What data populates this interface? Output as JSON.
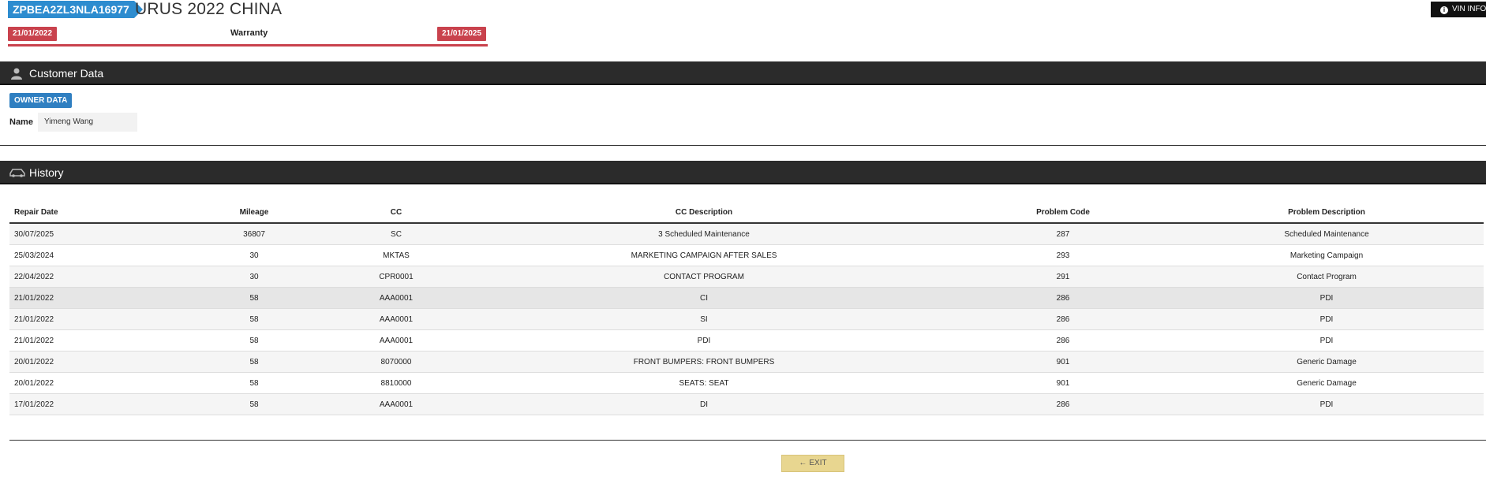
{
  "header": {
    "vin": "ZPBEA2ZL3NLA16977",
    "model": "URUS 2022 CHINA",
    "vin_info_label": "VIN INFO",
    "warranty_label": "Warranty",
    "warranty_start": "21/01/2022",
    "warranty_end": "21/01/2025"
  },
  "customer": {
    "section_title": "Customer Data",
    "owner_button": "OWNER DATA",
    "name_label": "Name",
    "name_value": "Yimeng Wang"
  },
  "history": {
    "section_title": "History",
    "columns": [
      "Repair Date",
      "Mileage",
      "CC",
      "CC Description",
      "Problem Code",
      "Problem Description"
    ],
    "rows": [
      [
        "30/07/2025",
        "36807",
        "SC",
        "3 Scheduled Maintenance",
        "287",
        "Scheduled Maintenance"
      ],
      [
        "25/03/2024",
        "30",
        "MKTAS",
        "MARKETING CAMPAIGN AFTER SALES",
        "293",
        "Marketing Campaign"
      ],
      [
        "22/04/2022",
        "30",
        "CPR0001",
        "CONTACT PROGRAM",
        "291",
        "Contact Program"
      ],
      [
        "21/01/2022",
        "58",
        "AAA0001",
        "CI",
        "286",
        "PDI"
      ],
      [
        "21/01/2022",
        "58",
        "AAA0001",
        "SI",
        "286",
        "PDI"
      ],
      [
        "21/01/2022",
        "58",
        "AAA0001",
        "PDI",
        "286",
        "PDI"
      ],
      [
        "20/01/2022",
        "58",
        "8070000",
        "FRONT BUMPERS: FRONT BUMPERS",
        "901",
        "Generic Damage"
      ],
      [
        "20/01/2022",
        "58",
        "8810000",
        "SEATS: SEAT",
        "901",
        "Generic Damage"
      ],
      [
        "17/01/2022",
        "58",
        "AAA0001",
        "DI",
        "286",
        "PDI"
      ]
    ]
  },
  "footer": {
    "exit_label": "EXIT"
  },
  "icons": {
    "customer": "person-icon",
    "history": "car-icon",
    "info": "info-icon",
    "exit": "arrow-left-icon"
  },
  "colors": {
    "vin_tag": "#2d8ccf",
    "warranty_red": "#c9424d",
    "section_bar": "#2b2b2b",
    "owner_button": "#2f7fc1",
    "exit_button": "#e8d690"
  }
}
